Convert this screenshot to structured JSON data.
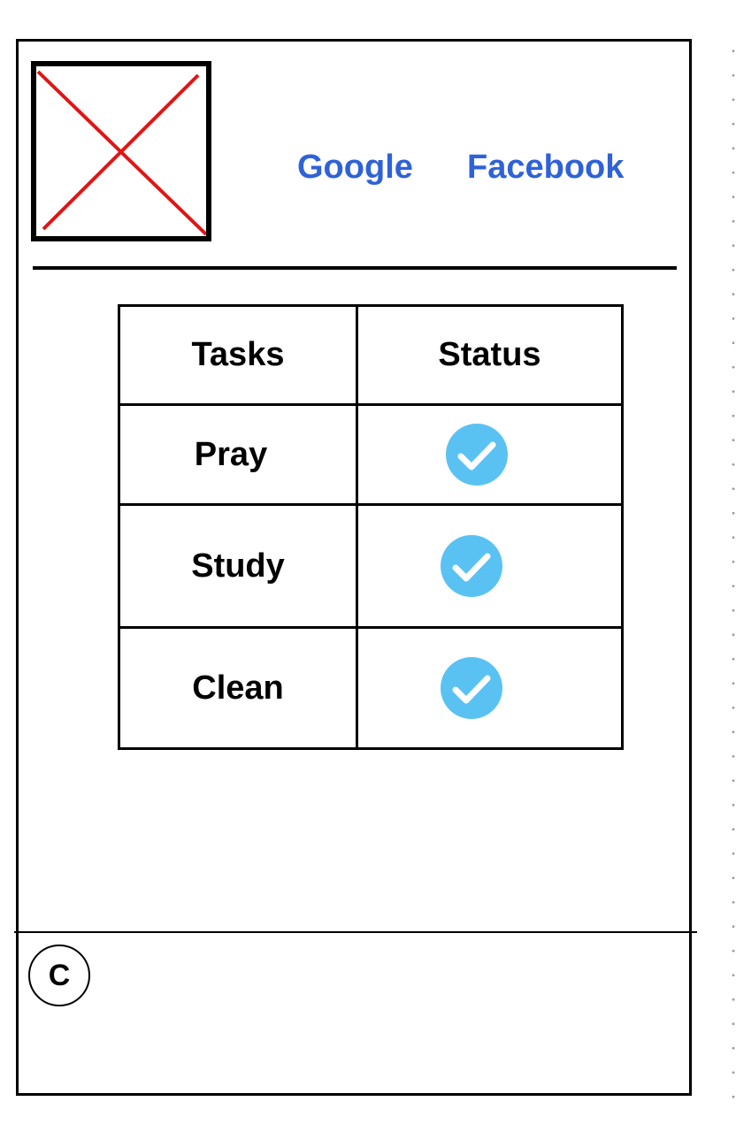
{
  "header": {
    "logo_icon": "image-placeholder-icon",
    "nav": {
      "google_label": "Google",
      "facebook_label": "Facebook",
      "link_color": "#2f62d8"
    }
  },
  "table": {
    "headers": {
      "task": "Tasks",
      "status": "Status"
    },
    "rows": [
      {
        "task": "Pray",
        "status_icon": "check-circle-icon"
      },
      {
        "task": "Study",
        "status_icon": "check-circle-icon"
      },
      {
        "task": "Clean",
        "status_icon": "check-circle-icon"
      }
    ],
    "check_color": "#5ac2f2"
  },
  "footer": {
    "copyright_label": "C"
  }
}
